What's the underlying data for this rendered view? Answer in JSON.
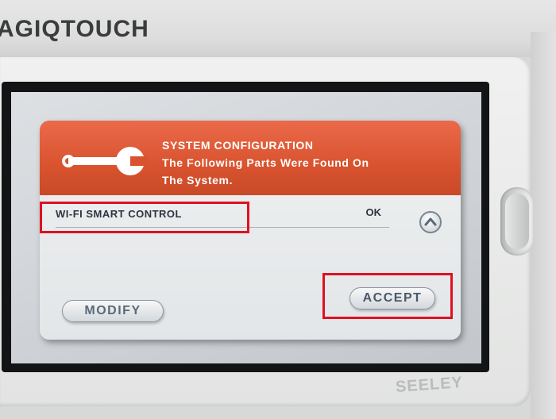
{
  "device": {
    "brand": "AGIQTOUCH",
    "maker_logo": "SEELEY"
  },
  "dialog": {
    "icon": "wrench-icon",
    "title": "SYSTEM CONFIGURATION",
    "message_line1": "The Following Parts Were Found On",
    "message_line2": "The System.",
    "parts": [
      {
        "name": "WI-FI SMART CONTROL",
        "status": "OK"
      }
    ],
    "scroll_up_icon": "chevron-up-icon",
    "buttons": {
      "modify": "MODIFY",
      "accept": "ACCEPT"
    }
  },
  "colors": {
    "header": "#d9532f",
    "highlight": "#e01020",
    "button_text": "#5b6a78"
  }
}
